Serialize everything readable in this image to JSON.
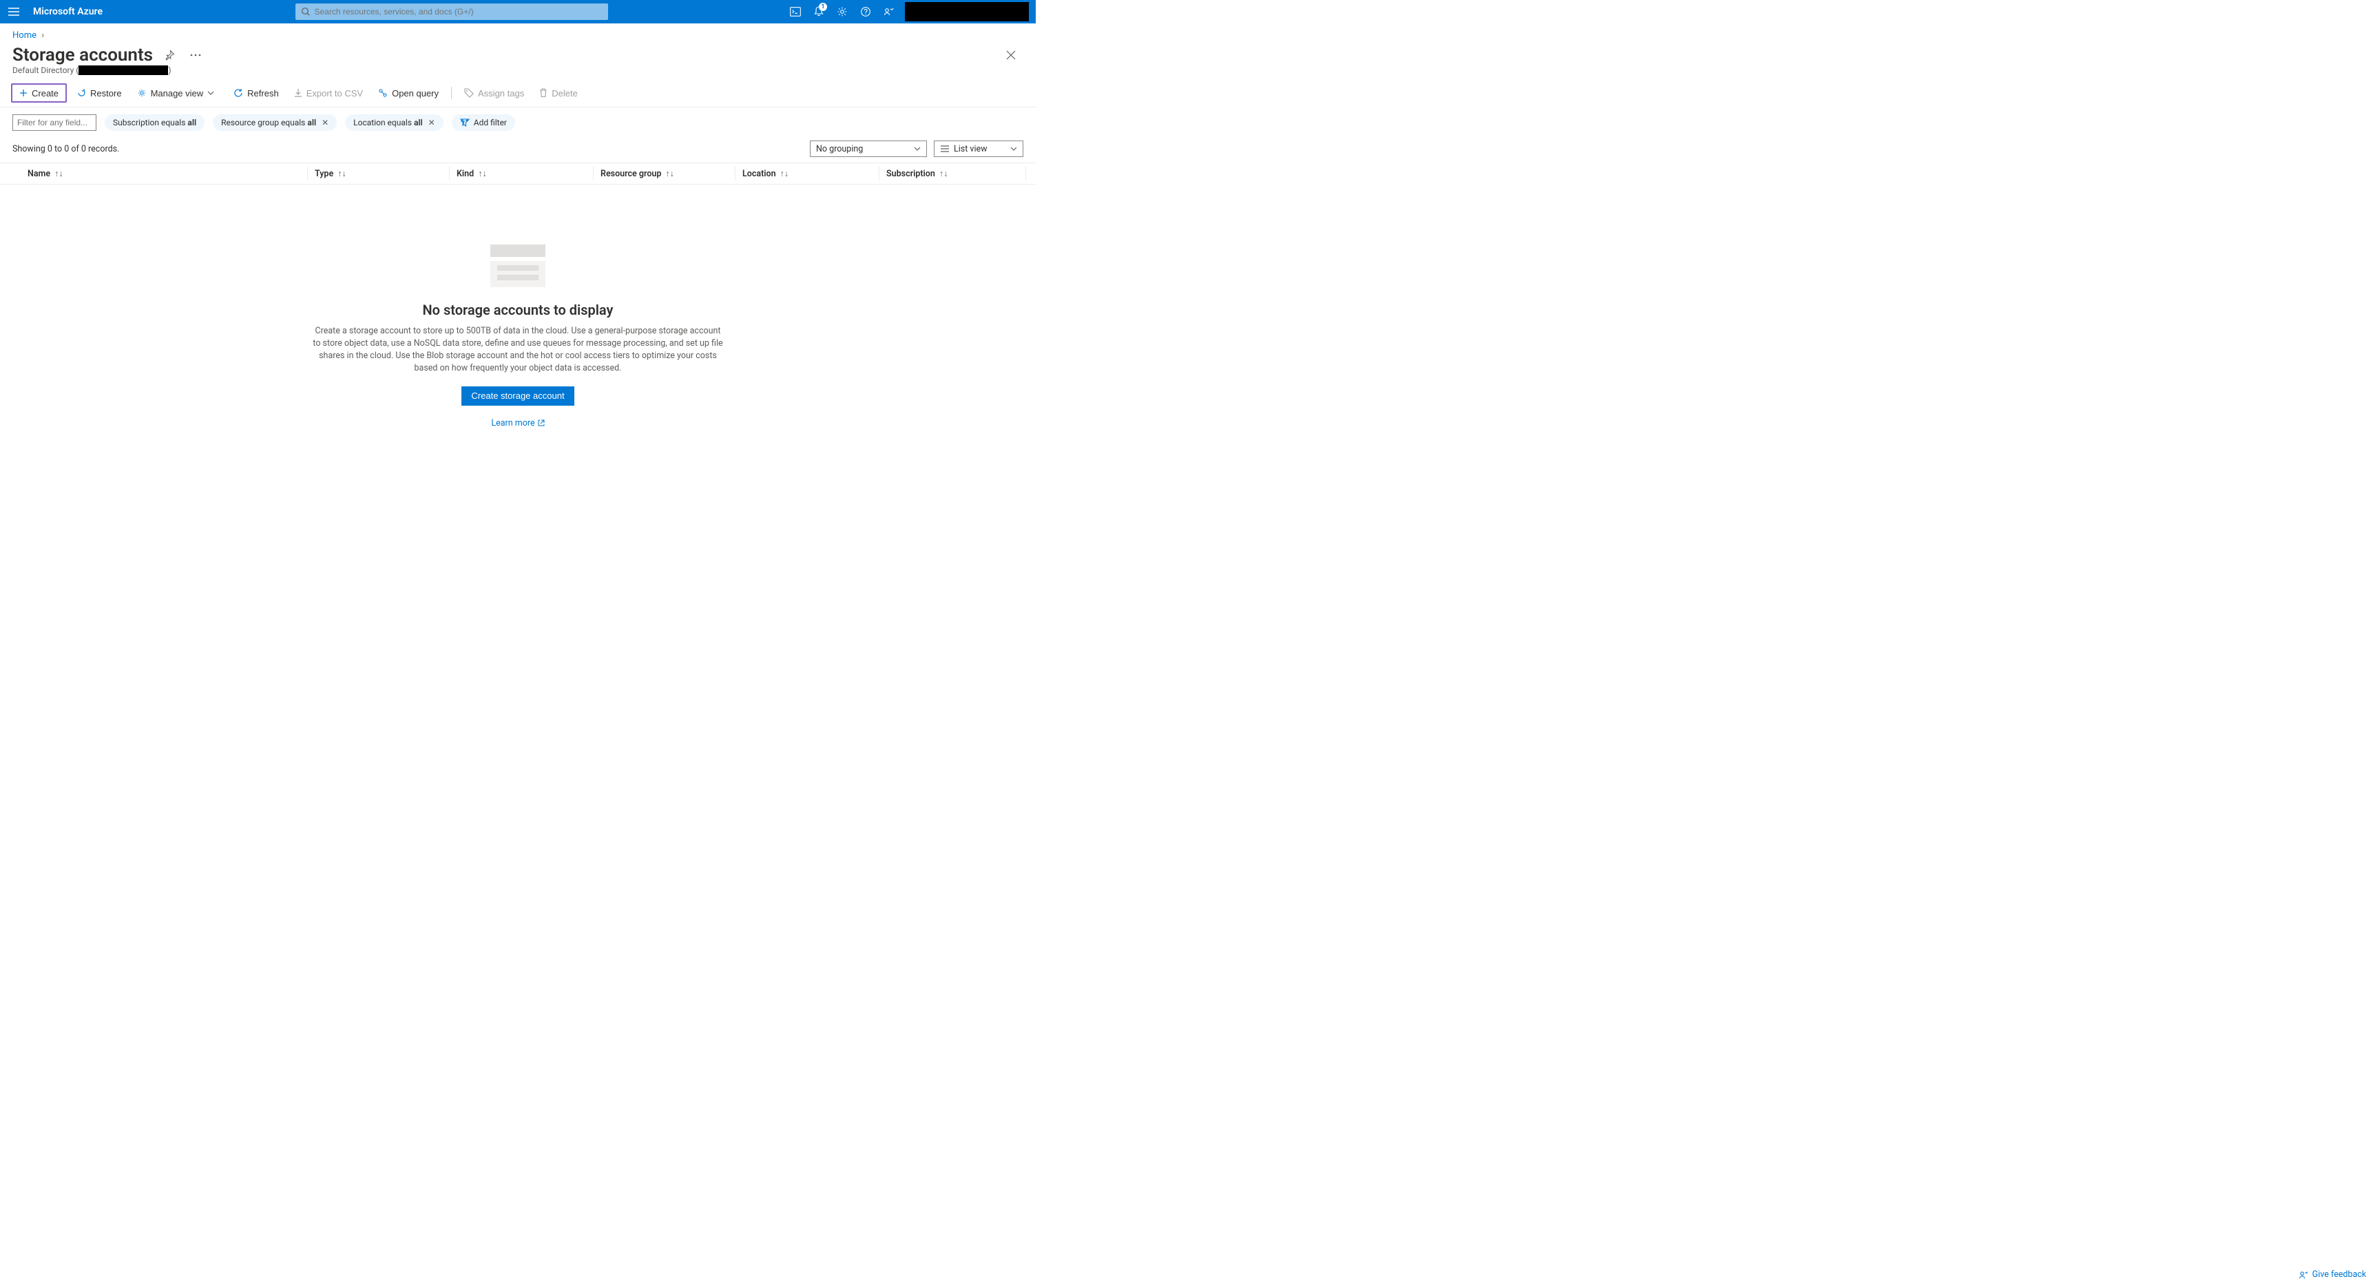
{
  "top": {
    "brand": "Microsoft Azure",
    "search_placeholder": "Search resources, services, and docs (G+/)",
    "notification_count": "1"
  },
  "breadcrumb": {
    "home": "Home"
  },
  "page": {
    "title": "Storage accounts",
    "subtitle_prefix": "Default Directory ("
  },
  "toolbar": {
    "create": "Create",
    "restore": "Restore",
    "manage_view": "Manage view",
    "refresh": "Refresh",
    "export_csv": "Export to CSV",
    "open_query": "Open query",
    "assign_tags": "Assign tags",
    "delete": "Delete"
  },
  "filters": {
    "input_placeholder": "Filter for any field...",
    "subscription_prefix": "Subscription equals",
    "subscription_value": "all",
    "rg_prefix": "Resource group equals",
    "rg_value": "all",
    "loc_prefix": "Location equals",
    "loc_value": "all",
    "add_filter": "Add filter"
  },
  "summary": {
    "records": "Showing 0 to 0 of 0 records.",
    "grouping": "No grouping",
    "view": "List view"
  },
  "columns": {
    "name": "Name",
    "type": "Type",
    "kind": "Kind",
    "rg": "Resource group",
    "location": "Location",
    "subscription": "Subscription"
  },
  "empty": {
    "heading": "No storage accounts to display",
    "body": "Create a storage account to store up to 500TB of data in the cloud. Use a general-purpose storage account to store object data, use a NoSQL data store, define and use queues for message processing, and set up file shares in the cloud. Use the Blob storage account and the hot or cool access tiers to optimize your costs based on how frequently your object data is accessed.",
    "create_btn": "Create storage account",
    "learn_more": "Learn more"
  },
  "feedback": {
    "label": "Give feedback"
  }
}
